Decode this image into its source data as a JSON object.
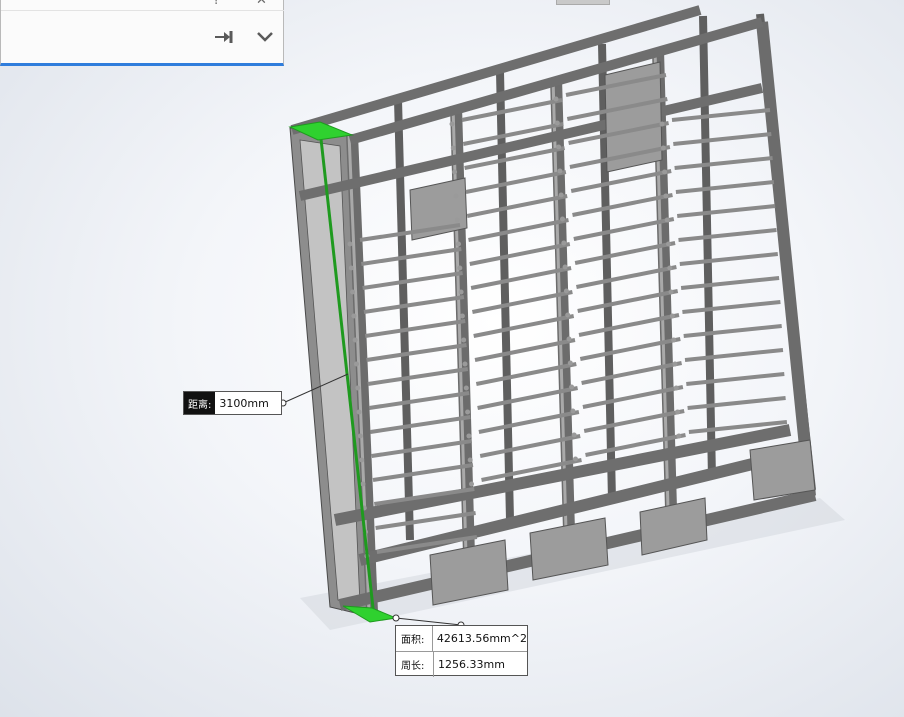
{
  "property_manager": {
    "help_icon": "question-icon",
    "close_icon": "close-icon",
    "pin_icon": "pushpin-icon",
    "expand_icon": "chevron-down-icon",
    "accent_color": "#2f7ddc"
  },
  "measure": {
    "distance_label": "距离:",
    "distance_value": "3100mm",
    "area_label": "面积:",
    "area_value": "42613.56mm^2",
    "perimeter_label": "周长:",
    "perimeter_value": "1256.33mm",
    "highlight_color": "#1f9a1f"
  }
}
